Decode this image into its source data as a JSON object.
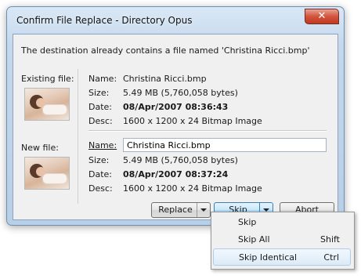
{
  "window": {
    "title": "Confirm File Replace - Directory Opus",
    "close_glyph": "✕"
  },
  "message": "The destination already contains a file named 'Christina Ricci.bmp'",
  "existing": {
    "section_label": "Existing file:",
    "name_label": "Name:",
    "name": "Christina Ricci.bmp",
    "size_label": "Size:",
    "size": "5.49 MB (5,760,058 bytes)",
    "date_label": "Date:",
    "date": "08/Apr/2007 08:36:43",
    "desc_label": "Desc:",
    "desc": "1600 x 1200 x 24 Bitmap Image"
  },
  "new_file": {
    "section_label": "New file:",
    "name_label": "Name:",
    "name": "Christina Ricci.bmp",
    "size_label": "Size:",
    "size": "5.49 MB (5,760,058 bytes)",
    "date_label": "Date:",
    "date": "08/Apr/2007 08:37:24",
    "desc_label": "Desc:",
    "desc": "1600 x 1200 x 24 Bitmap Image"
  },
  "buttons": {
    "replace": "Replace",
    "skip": "Skip",
    "abort": "Abort"
  },
  "menu": {
    "items": [
      {
        "label": "Skip",
        "shortcut": ""
      },
      {
        "label": "Skip All",
        "shortcut": "Shift"
      },
      {
        "label": "Skip Identical",
        "shortcut": "Ctrl"
      }
    ]
  },
  "colors": {
    "title_bar": "#c4d8ec",
    "close_button": "#d2543d",
    "skip_button": "#c9e7fa",
    "client_bg": "#f0f0f0"
  },
  "icons": [
    "close-icon",
    "chevron-down-icon"
  ]
}
